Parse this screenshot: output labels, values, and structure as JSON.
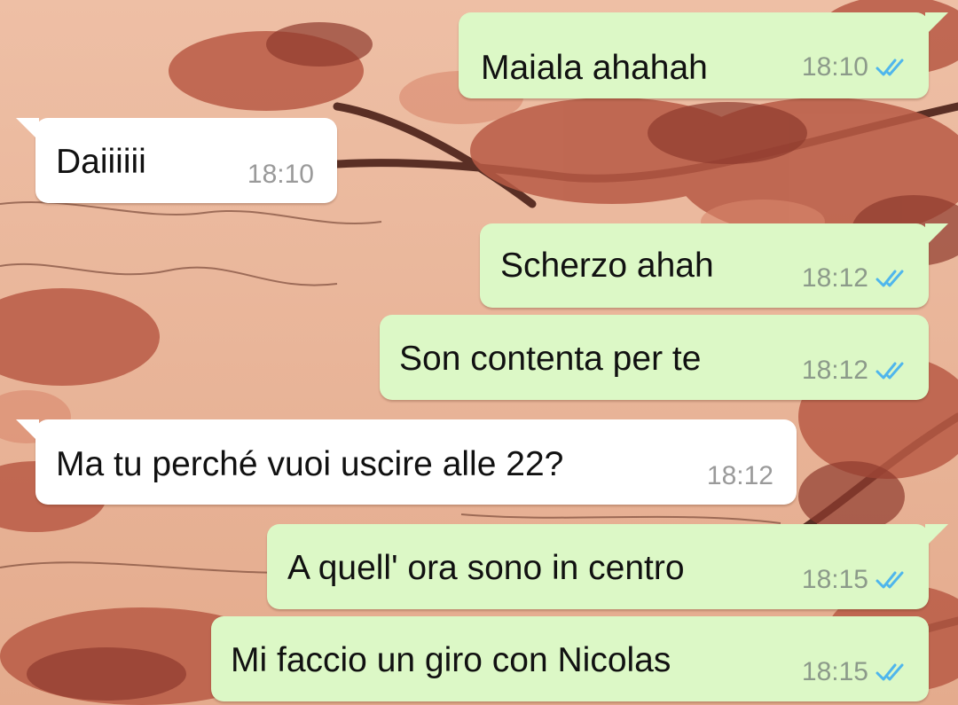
{
  "theme": {
    "outgoing_bubble": "#dcf8c6",
    "incoming_bubble": "#ffffff",
    "read_tick_color": "#4fb6ec",
    "wallpaper_base": "#e9b69a"
  },
  "messages": [
    {
      "direction": "out",
      "text": "Maiala ahahah",
      "time": "18:10",
      "status": "read-double-check-icon"
    },
    {
      "direction": "in",
      "text": "Daiiiiii",
      "time": "18:10"
    },
    {
      "direction": "out",
      "text": "Scherzo ahah",
      "time": "18:12",
      "status": "read-double-check-icon"
    },
    {
      "direction": "out",
      "text": "Son contenta per te",
      "time": "18:12",
      "status": "read-double-check-icon"
    },
    {
      "direction": "in",
      "text": "Ma tu perché vuoi uscire alle 22?",
      "time": "18:12"
    },
    {
      "direction": "out",
      "text": "A quell' ora sono in centro",
      "time": "18:15",
      "status": "read-double-check-icon"
    },
    {
      "direction": "out",
      "text": "Mi faccio un giro con Nicolas",
      "time": "18:15",
      "status": "read-double-check-icon"
    }
  ]
}
